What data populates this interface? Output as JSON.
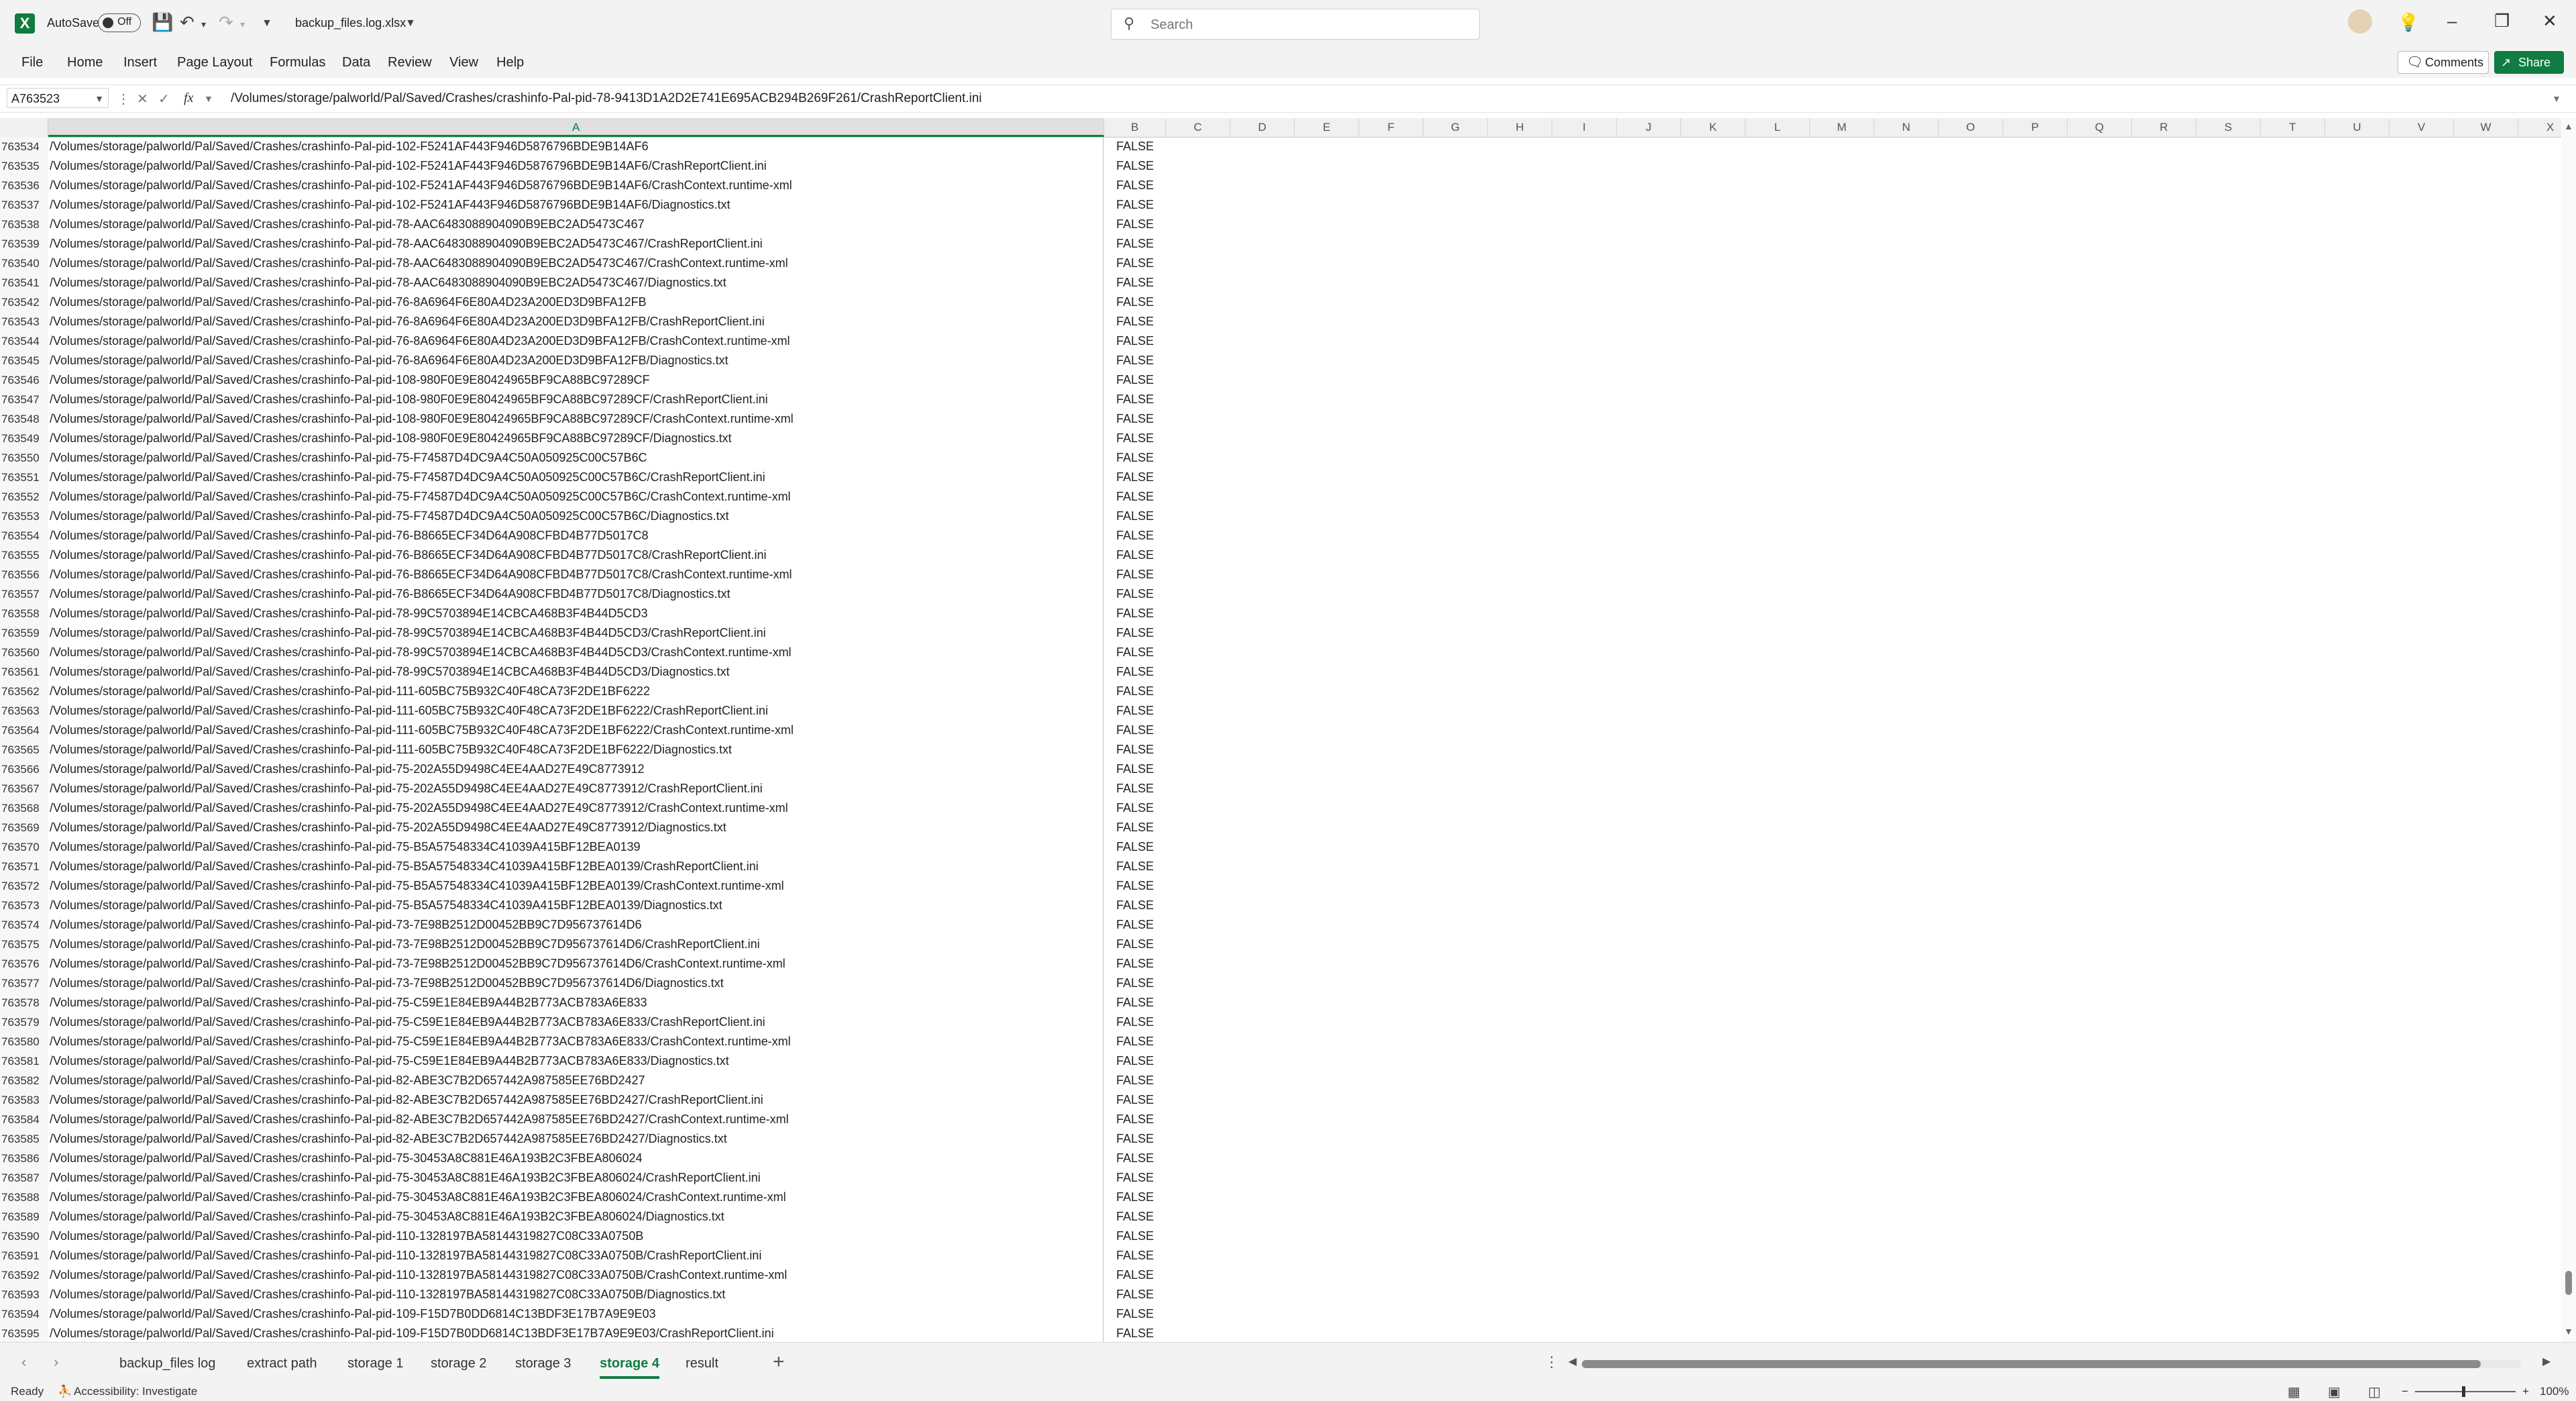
{
  "titlebar": {
    "app_icon": "X",
    "autosave_label": "AutoSave",
    "autosave_state": "Off",
    "filename": "backup_files.log.xlsx",
    "search_placeholder": "Search",
    "icons": [
      "save-icon",
      "undo-icon",
      "redo-icon",
      "customize-icon",
      "avatar",
      "lightbulb-icon",
      "minimize-icon",
      "restore-icon",
      "close-icon"
    ]
  },
  "ribbon": {
    "tabs": [
      "File",
      "Home",
      "Insert",
      "Page Layout",
      "Formulas",
      "Data",
      "Review",
      "View",
      "Help"
    ],
    "comments_label": "Comments",
    "share_label": "Share"
  },
  "formula_bar": {
    "name_box": "A763523",
    "fx": "fx",
    "content": "/Volumes/storage/palworld/Pal/Saved/Crashes/crashinfo-Pal-pid-78-9413D1A2D2E741E695ACB294B269F261/CrashReportClient.ini"
  },
  "columns": [
    "A",
    "B",
    "C",
    "D",
    "E",
    "F",
    "G",
    "H",
    "I",
    "J",
    "K",
    "L",
    "M",
    "N",
    "O",
    "P",
    "Q",
    "R",
    "S",
    "T",
    "U",
    "V",
    "W",
    "X"
  ],
  "rows": [
    {
      "n": "763534",
      "a": "/Volumes/storage/palworld/Pal/Saved/Crashes/crashinfo-Pal-pid-102-F5241AF443F946D5876796BDE9B14AF6",
      "b": "FALSE"
    },
    {
      "n": "763535",
      "a": "/Volumes/storage/palworld/Pal/Saved/Crashes/crashinfo-Pal-pid-102-F5241AF443F946D5876796BDE9B14AF6/CrashReportClient.ini",
      "b": "FALSE"
    },
    {
      "n": "763536",
      "a": "/Volumes/storage/palworld/Pal/Saved/Crashes/crashinfo-Pal-pid-102-F5241AF443F946D5876796BDE9B14AF6/CrashContext.runtime-xml",
      "b": "FALSE"
    },
    {
      "n": "763537",
      "a": "/Volumes/storage/palworld/Pal/Saved/Crashes/crashinfo-Pal-pid-102-F5241AF443F946D5876796BDE9B14AF6/Diagnostics.txt",
      "b": "FALSE"
    },
    {
      "n": "763538",
      "a": "/Volumes/storage/palworld/Pal/Saved/Crashes/crashinfo-Pal-pid-78-AAC6483088904090B9EBC2AD5473C467",
      "b": "FALSE"
    },
    {
      "n": "763539",
      "a": "/Volumes/storage/palworld/Pal/Saved/Crashes/crashinfo-Pal-pid-78-AAC6483088904090B9EBC2AD5473C467/CrashReportClient.ini",
      "b": "FALSE"
    },
    {
      "n": "763540",
      "a": "/Volumes/storage/palworld/Pal/Saved/Crashes/crashinfo-Pal-pid-78-AAC6483088904090B9EBC2AD5473C467/CrashContext.runtime-xml",
      "b": "FALSE"
    },
    {
      "n": "763541",
      "a": "/Volumes/storage/palworld/Pal/Saved/Crashes/crashinfo-Pal-pid-78-AAC6483088904090B9EBC2AD5473C467/Diagnostics.txt",
      "b": "FALSE"
    },
    {
      "n": "763542",
      "a": "/Volumes/storage/palworld/Pal/Saved/Crashes/crashinfo-Pal-pid-76-8A6964F6E80A4D23A200ED3D9BFA12FB",
      "b": "FALSE"
    },
    {
      "n": "763543",
      "a": "/Volumes/storage/palworld/Pal/Saved/Crashes/crashinfo-Pal-pid-76-8A6964F6E80A4D23A200ED3D9BFA12FB/CrashReportClient.ini",
      "b": "FALSE"
    },
    {
      "n": "763544",
      "a": "/Volumes/storage/palworld/Pal/Saved/Crashes/crashinfo-Pal-pid-76-8A6964F6E80A4D23A200ED3D9BFA12FB/CrashContext.runtime-xml",
      "b": "FALSE"
    },
    {
      "n": "763545",
      "a": "/Volumes/storage/palworld/Pal/Saved/Crashes/crashinfo-Pal-pid-76-8A6964F6E80A4D23A200ED3D9BFA12FB/Diagnostics.txt",
      "b": "FALSE"
    },
    {
      "n": "763546",
      "a": "/Volumes/storage/palworld/Pal/Saved/Crashes/crashinfo-Pal-pid-108-980F0E9E80424965BF9CA88BC97289CF",
      "b": "FALSE"
    },
    {
      "n": "763547",
      "a": "/Volumes/storage/palworld/Pal/Saved/Crashes/crashinfo-Pal-pid-108-980F0E9E80424965BF9CA88BC97289CF/CrashReportClient.ini",
      "b": "FALSE"
    },
    {
      "n": "763548",
      "a": "/Volumes/storage/palworld/Pal/Saved/Crashes/crashinfo-Pal-pid-108-980F0E9E80424965BF9CA88BC97289CF/CrashContext.runtime-xml",
      "b": "FALSE"
    },
    {
      "n": "763549",
      "a": "/Volumes/storage/palworld/Pal/Saved/Crashes/crashinfo-Pal-pid-108-980F0E9E80424965BF9CA88BC97289CF/Diagnostics.txt",
      "b": "FALSE"
    },
    {
      "n": "763550",
      "a": "/Volumes/storage/palworld/Pal/Saved/Crashes/crashinfo-Pal-pid-75-F74587D4DC9A4C50A050925C00C57B6C",
      "b": "FALSE"
    },
    {
      "n": "763551",
      "a": "/Volumes/storage/palworld/Pal/Saved/Crashes/crashinfo-Pal-pid-75-F74587D4DC9A4C50A050925C00C57B6C/CrashReportClient.ini",
      "b": "FALSE"
    },
    {
      "n": "763552",
      "a": "/Volumes/storage/palworld/Pal/Saved/Crashes/crashinfo-Pal-pid-75-F74587D4DC9A4C50A050925C00C57B6C/CrashContext.runtime-xml",
      "b": "FALSE"
    },
    {
      "n": "763553",
      "a": "/Volumes/storage/palworld/Pal/Saved/Crashes/crashinfo-Pal-pid-75-F74587D4DC9A4C50A050925C00C57B6C/Diagnostics.txt",
      "b": "FALSE"
    },
    {
      "n": "763554",
      "a": "/Volumes/storage/palworld/Pal/Saved/Crashes/crashinfo-Pal-pid-76-B8665ECF34D64A908CFBD4B77D5017C8",
      "b": "FALSE"
    },
    {
      "n": "763555",
      "a": "/Volumes/storage/palworld/Pal/Saved/Crashes/crashinfo-Pal-pid-76-B8665ECF34D64A908CFBD4B77D5017C8/CrashReportClient.ini",
      "b": "FALSE"
    },
    {
      "n": "763556",
      "a": "/Volumes/storage/palworld/Pal/Saved/Crashes/crashinfo-Pal-pid-76-B8665ECF34D64A908CFBD4B77D5017C8/CrashContext.runtime-xml",
      "b": "FALSE"
    },
    {
      "n": "763557",
      "a": "/Volumes/storage/palworld/Pal/Saved/Crashes/crashinfo-Pal-pid-76-B8665ECF34D64A908CFBD4B77D5017C8/Diagnostics.txt",
      "b": "FALSE"
    },
    {
      "n": "763558",
      "a": "/Volumes/storage/palworld/Pal/Saved/Crashes/crashinfo-Pal-pid-78-99C5703894E14CBCA468B3F4B44D5CD3",
      "b": "FALSE"
    },
    {
      "n": "763559",
      "a": "/Volumes/storage/palworld/Pal/Saved/Crashes/crashinfo-Pal-pid-78-99C5703894E14CBCA468B3F4B44D5CD3/CrashReportClient.ini",
      "b": "FALSE"
    },
    {
      "n": "763560",
      "a": "/Volumes/storage/palworld/Pal/Saved/Crashes/crashinfo-Pal-pid-78-99C5703894E14CBCA468B3F4B44D5CD3/CrashContext.runtime-xml",
      "b": "FALSE"
    },
    {
      "n": "763561",
      "a": "/Volumes/storage/palworld/Pal/Saved/Crashes/crashinfo-Pal-pid-78-99C5703894E14CBCA468B3F4B44D5CD3/Diagnostics.txt",
      "b": "FALSE"
    },
    {
      "n": "763562",
      "a": "/Volumes/storage/palworld/Pal/Saved/Crashes/crashinfo-Pal-pid-111-605BC75B932C40F48CA73F2DE1BF6222",
      "b": "FALSE"
    },
    {
      "n": "763563",
      "a": "/Volumes/storage/palworld/Pal/Saved/Crashes/crashinfo-Pal-pid-111-605BC75B932C40F48CA73F2DE1BF6222/CrashReportClient.ini",
      "b": "FALSE"
    },
    {
      "n": "763564",
      "a": "/Volumes/storage/palworld/Pal/Saved/Crashes/crashinfo-Pal-pid-111-605BC75B932C40F48CA73F2DE1BF6222/CrashContext.runtime-xml",
      "b": "FALSE"
    },
    {
      "n": "763565",
      "a": "/Volumes/storage/palworld/Pal/Saved/Crashes/crashinfo-Pal-pid-111-605BC75B932C40F48CA73F2DE1BF6222/Diagnostics.txt",
      "b": "FALSE"
    },
    {
      "n": "763566",
      "a": "/Volumes/storage/palworld/Pal/Saved/Crashes/crashinfo-Pal-pid-75-202A55D9498C4EE4AAD27E49C8773912",
      "b": "FALSE"
    },
    {
      "n": "763567",
      "a": "/Volumes/storage/palworld/Pal/Saved/Crashes/crashinfo-Pal-pid-75-202A55D9498C4EE4AAD27E49C8773912/CrashReportClient.ini",
      "b": "FALSE"
    },
    {
      "n": "763568",
      "a": "/Volumes/storage/palworld/Pal/Saved/Crashes/crashinfo-Pal-pid-75-202A55D9498C4EE4AAD27E49C8773912/CrashContext.runtime-xml",
      "b": "FALSE"
    },
    {
      "n": "763569",
      "a": "/Volumes/storage/palworld/Pal/Saved/Crashes/crashinfo-Pal-pid-75-202A55D9498C4EE4AAD27E49C8773912/Diagnostics.txt",
      "b": "FALSE"
    },
    {
      "n": "763570",
      "a": "/Volumes/storage/palworld/Pal/Saved/Crashes/crashinfo-Pal-pid-75-B5A57548334C41039A415BF12BEA0139",
      "b": "FALSE"
    },
    {
      "n": "763571",
      "a": "/Volumes/storage/palworld/Pal/Saved/Crashes/crashinfo-Pal-pid-75-B5A57548334C41039A415BF12BEA0139/CrashReportClient.ini",
      "b": "FALSE"
    },
    {
      "n": "763572",
      "a": "/Volumes/storage/palworld/Pal/Saved/Crashes/crashinfo-Pal-pid-75-B5A57548334C41039A415BF12BEA0139/CrashContext.runtime-xml",
      "b": "FALSE"
    },
    {
      "n": "763573",
      "a": "/Volumes/storage/palworld/Pal/Saved/Crashes/crashinfo-Pal-pid-75-B5A57548334C41039A415BF12BEA0139/Diagnostics.txt",
      "b": "FALSE"
    },
    {
      "n": "763574",
      "a": "/Volumes/storage/palworld/Pal/Saved/Crashes/crashinfo-Pal-pid-73-7E98B2512D00452BB9C7D956737614D6",
      "b": "FALSE"
    },
    {
      "n": "763575",
      "a": "/Volumes/storage/palworld/Pal/Saved/Crashes/crashinfo-Pal-pid-73-7E98B2512D00452BB9C7D956737614D6/CrashReportClient.ini",
      "b": "FALSE"
    },
    {
      "n": "763576",
      "a": "/Volumes/storage/palworld/Pal/Saved/Crashes/crashinfo-Pal-pid-73-7E98B2512D00452BB9C7D956737614D6/CrashContext.runtime-xml",
      "b": "FALSE"
    },
    {
      "n": "763577",
      "a": "/Volumes/storage/palworld/Pal/Saved/Crashes/crashinfo-Pal-pid-73-7E98B2512D00452BB9C7D956737614D6/Diagnostics.txt",
      "b": "FALSE"
    },
    {
      "n": "763578",
      "a": "/Volumes/storage/palworld/Pal/Saved/Crashes/crashinfo-Pal-pid-75-C59E1E84EB9A44B2B773ACB783A6E833",
      "b": "FALSE"
    },
    {
      "n": "763579",
      "a": "/Volumes/storage/palworld/Pal/Saved/Crashes/crashinfo-Pal-pid-75-C59E1E84EB9A44B2B773ACB783A6E833/CrashReportClient.ini",
      "b": "FALSE"
    },
    {
      "n": "763580",
      "a": "/Volumes/storage/palworld/Pal/Saved/Crashes/crashinfo-Pal-pid-75-C59E1E84EB9A44B2B773ACB783A6E833/CrashContext.runtime-xml",
      "b": "FALSE"
    },
    {
      "n": "763581",
      "a": "/Volumes/storage/palworld/Pal/Saved/Crashes/crashinfo-Pal-pid-75-C59E1E84EB9A44B2B773ACB783A6E833/Diagnostics.txt",
      "b": "FALSE"
    },
    {
      "n": "763582",
      "a": "/Volumes/storage/palworld/Pal/Saved/Crashes/crashinfo-Pal-pid-82-ABE3C7B2D657442A987585EE76BD2427",
      "b": "FALSE"
    },
    {
      "n": "763583",
      "a": "/Volumes/storage/palworld/Pal/Saved/Crashes/crashinfo-Pal-pid-82-ABE3C7B2D657442A987585EE76BD2427/CrashReportClient.ini",
      "b": "FALSE"
    },
    {
      "n": "763584",
      "a": "/Volumes/storage/palworld/Pal/Saved/Crashes/crashinfo-Pal-pid-82-ABE3C7B2D657442A987585EE76BD2427/CrashContext.runtime-xml",
      "b": "FALSE"
    },
    {
      "n": "763585",
      "a": "/Volumes/storage/palworld/Pal/Saved/Crashes/crashinfo-Pal-pid-82-ABE3C7B2D657442A987585EE76BD2427/Diagnostics.txt",
      "b": "FALSE"
    },
    {
      "n": "763586",
      "a": "/Volumes/storage/palworld/Pal/Saved/Crashes/crashinfo-Pal-pid-75-30453A8C881E46A193B2C3FBEA806024",
      "b": "FALSE"
    },
    {
      "n": "763587",
      "a": "/Volumes/storage/palworld/Pal/Saved/Crashes/crashinfo-Pal-pid-75-30453A8C881E46A193B2C3FBEA806024/CrashReportClient.ini",
      "b": "FALSE"
    },
    {
      "n": "763588",
      "a": "/Volumes/storage/palworld/Pal/Saved/Crashes/crashinfo-Pal-pid-75-30453A8C881E46A193B2C3FBEA806024/CrashContext.runtime-xml",
      "b": "FALSE"
    },
    {
      "n": "763589",
      "a": "/Volumes/storage/palworld/Pal/Saved/Crashes/crashinfo-Pal-pid-75-30453A8C881E46A193B2C3FBEA806024/Diagnostics.txt",
      "b": "FALSE"
    },
    {
      "n": "763590",
      "a": "/Volumes/storage/palworld/Pal/Saved/Crashes/crashinfo-Pal-pid-110-1328197BA58144319827C08C33A0750B",
      "b": "FALSE"
    },
    {
      "n": "763591",
      "a": "/Volumes/storage/palworld/Pal/Saved/Crashes/crashinfo-Pal-pid-110-1328197BA58144319827C08C33A0750B/CrashReportClient.ini",
      "b": "FALSE"
    },
    {
      "n": "763592",
      "a": "/Volumes/storage/palworld/Pal/Saved/Crashes/crashinfo-Pal-pid-110-1328197BA58144319827C08C33A0750B/CrashContext.runtime-xml",
      "b": "FALSE"
    },
    {
      "n": "763593",
      "a": "/Volumes/storage/palworld/Pal/Saved/Crashes/crashinfo-Pal-pid-110-1328197BA58144319827C08C33A0750B/Diagnostics.txt",
      "b": "FALSE"
    },
    {
      "n": "763594",
      "a": "/Volumes/storage/palworld/Pal/Saved/Crashes/crashinfo-Pal-pid-109-F15D7B0DD6814C13BDF3E17B7A9E9E03",
      "b": "FALSE"
    },
    {
      "n": "763595",
      "a": "/Volumes/storage/palworld/Pal/Saved/Crashes/crashinfo-Pal-pid-109-F15D7B0DD6814C13BDF3E17B7A9E9E03/CrashReportClient.ini",
      "b": "FALSE"
    }
  ],
  "sheets": [
    "backup_files log",
    "extract path",
    "storage 1",
    "storage 2",
    "storage 3",
    "storage 4",
    "result"
  ],
  "active_sheet": "storage 4",
  "status": {
    "ready": "Ready",
    "accessibility": "Accessibility: Investigate",
    "zoom": "100%"
  },
  "colors": {
    "accent": "#107c41"
  }
}
